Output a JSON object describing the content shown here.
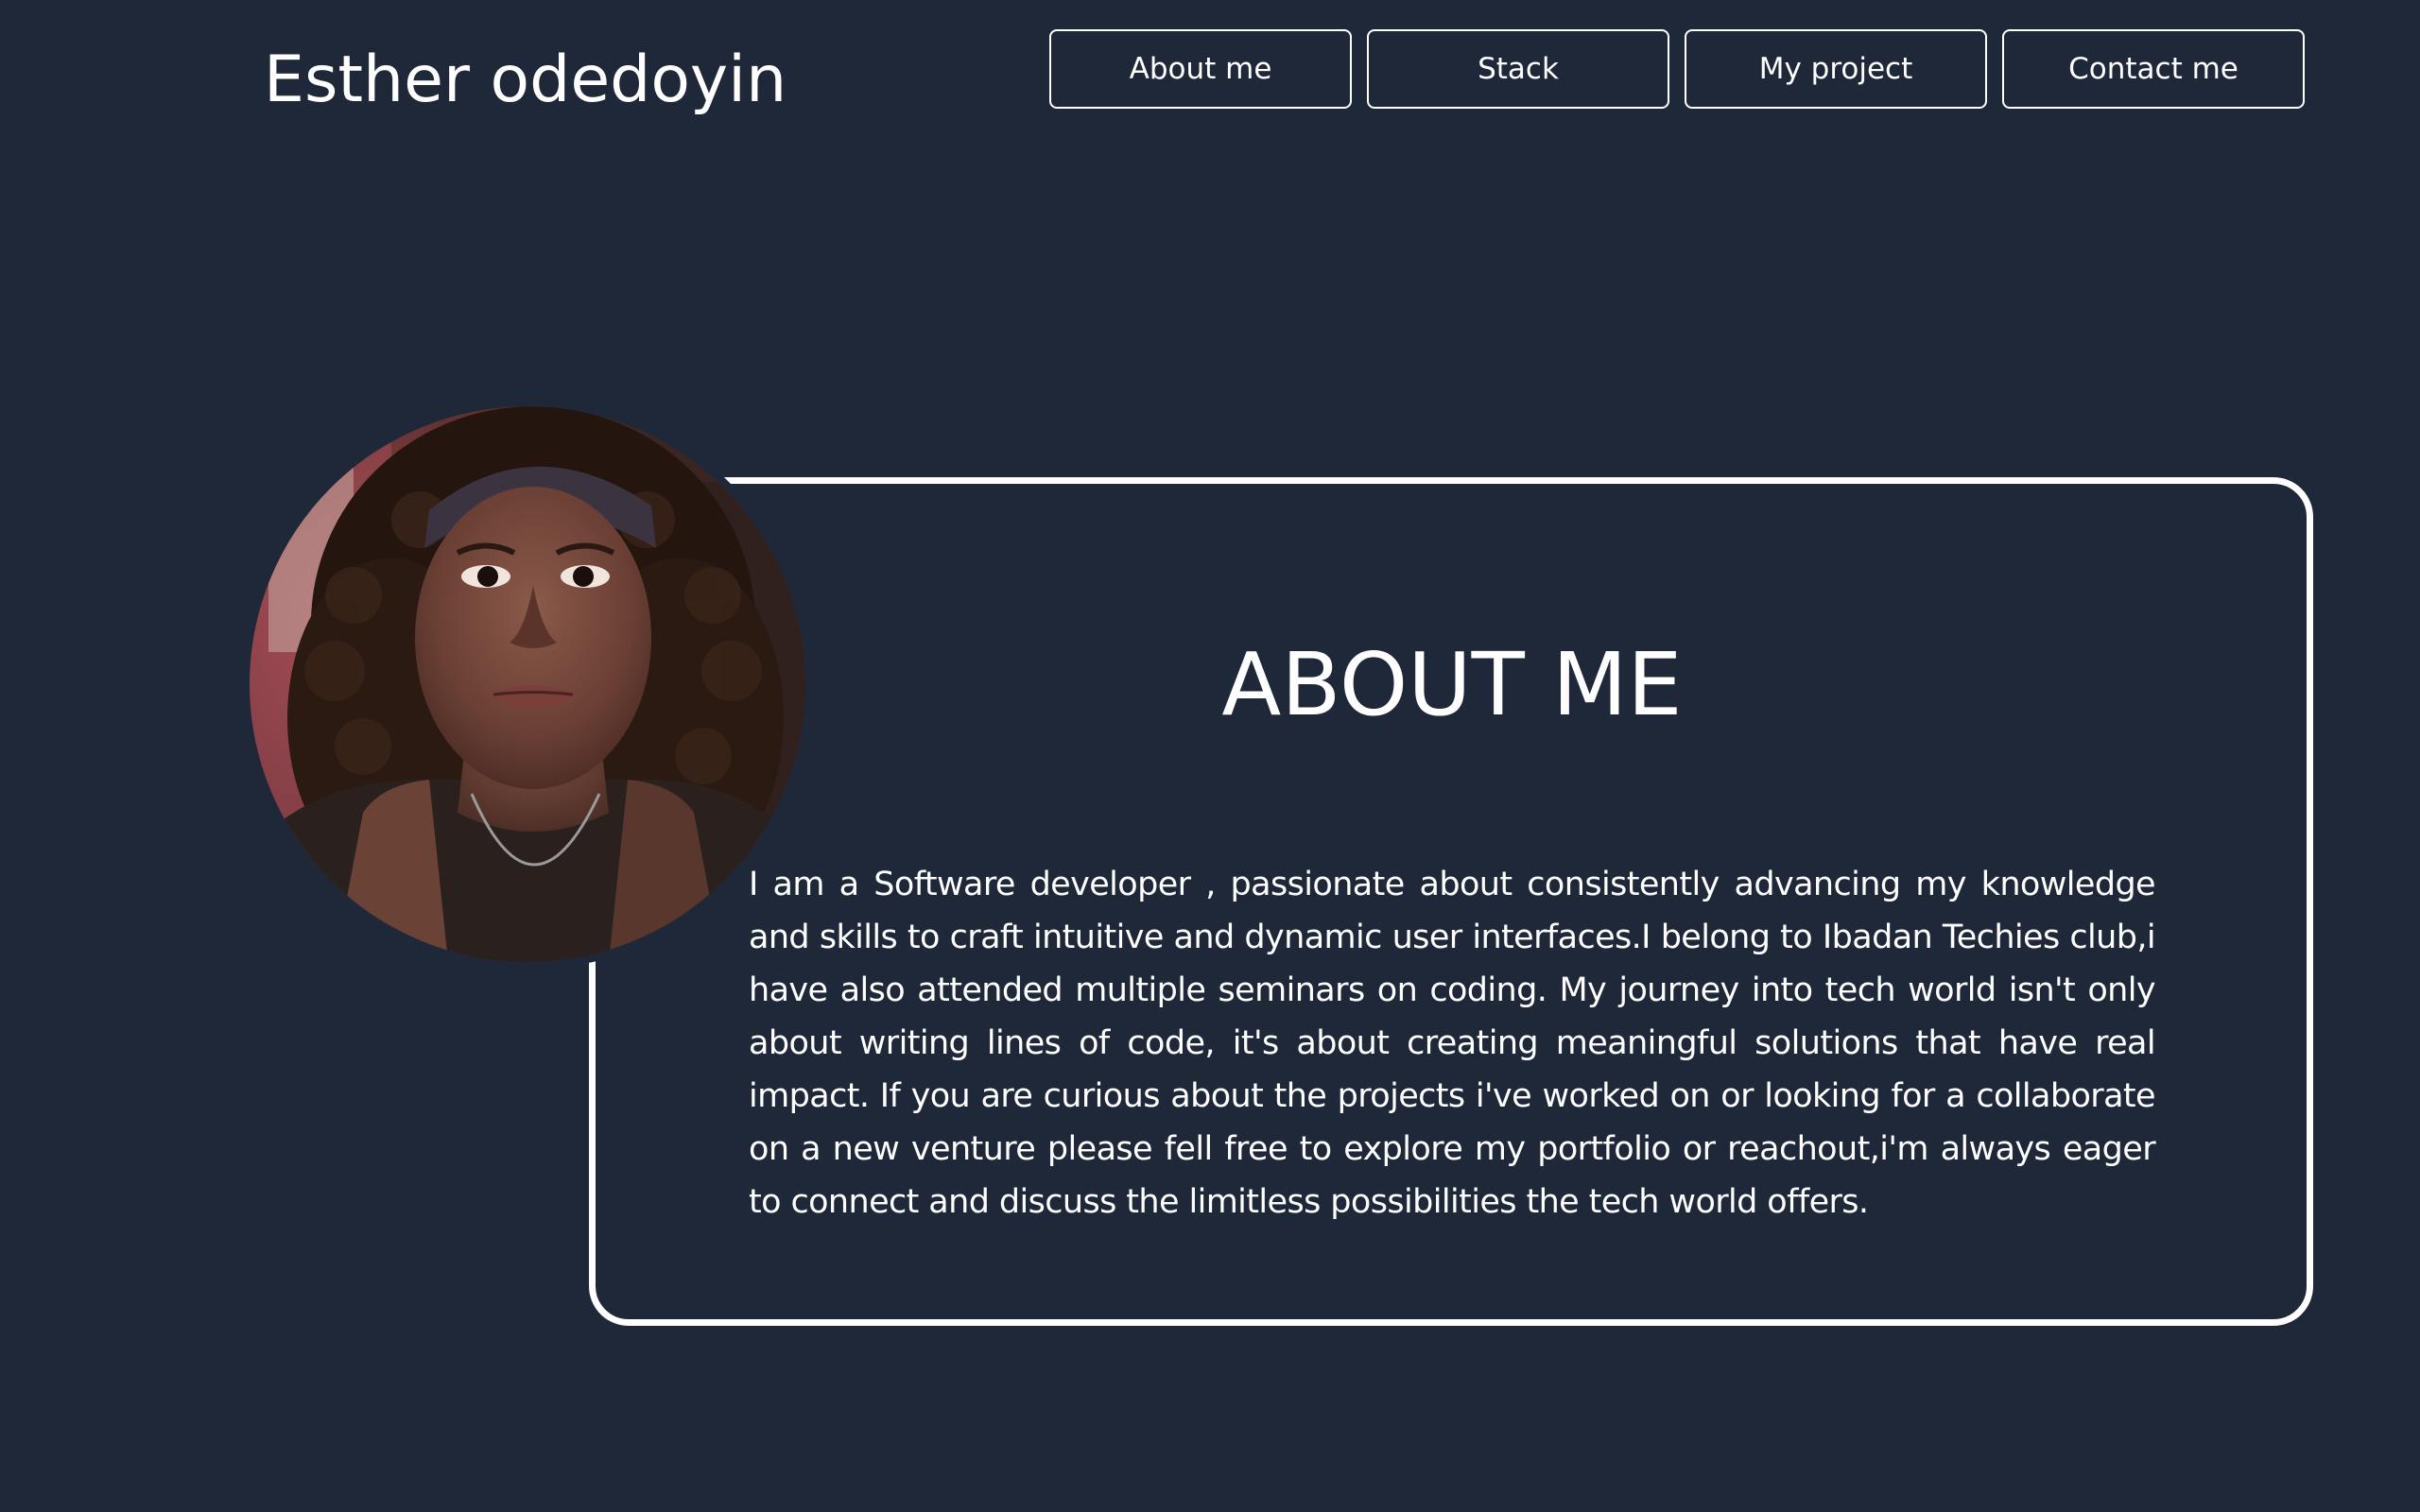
{
  "header": {
    "site_name": "Esther odedoyin",
    "nav": [
      {
        "label": "About me"
      },
      {
        "label": "Stack"
      },
      {
        "label": "My project"
      },
      {
        "label": "Contact me"
      }
    ]
  },
  "about": {
    "title": "ABOUT ME",
    "text": "I am a Software developer , passionate about consistently advancing my knowledge and skills to craft intuitive and dynamic user interfaces.I belong to Ibadan Techies club,i have also attended multiple seminars on coding. My journey into tech world isn't only about writing lines of code, it's about creating meaningful solutions that have real impact. If you are curious about the projects i've worked on or looking for a collaborate on a new venture please fell free to explore my portfolio or reachout,i'm always eager to connect and discuss the limitless possibilities the tech world offers."
  },
  "colors": {
    "background": "#1f2838",
    "foreground": "#ffffff"
  },
  "icons": {
    "profile_photo": "profile-photo"
  }
}
